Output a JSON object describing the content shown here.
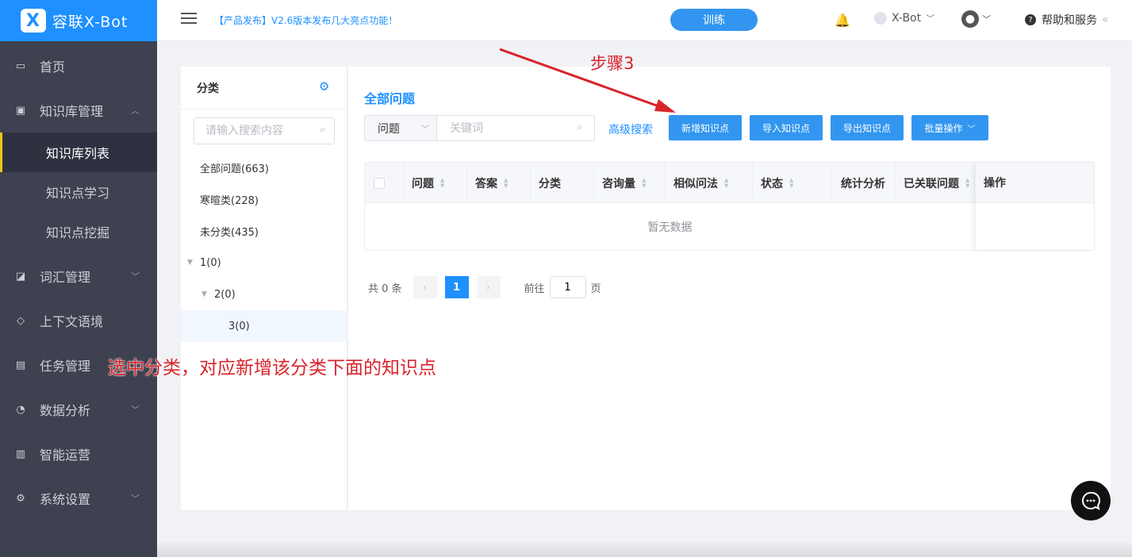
{
  "app": {
    "logo_text": "容联X-Bot",
    "logo_mark": "X"
  },
  "sidebar": {
    "items": [
      {
        "label": "首页",
        "icon": "monitor-icon"
      },
      {
        "label": "知识库管理",
        "icon": "book-icon"
      },
      {
        "label": "词汇管理",
        "icon": "vocab-icon"
      },
      {
        "label": "上下文语境",
        "icon": "context-icon"
      },
      {
        "label": "任务管理",
        "icon": "task-icon"
      },
      {
        "label": "数据分析",
        "icon": "analytics-icon"
      },
      {
        "label": "智能运营",
        "icon": "operation-icon"
      },
      {
        "label": "系统设置",
        "icon": "settings-icon"
      }
    ],
    "sub_items": [
      {
        "label": "知识库列表"
      },
      {
        "label": "知识点学习"
      },
      {
        "label": "知识点挖掘"
      }
    ]
  },
  "header": {
    "release_notice": "【产品发布】V2.6版本发布几大亮点功能！",
    "train_label": "训练",
    "bot_name": "X-Bot",
    "help_label": "帮助和服务"
  },
  "category": {
    "title": "分类",
    "search_placeholder": "请输入搜索内容",
    "items": [
      {
        "label": "全部问题(663)"
      },
      {
        "label": "寒暄类(228)"
      },
      {
        "label": "未分类(435)"
      },
      {
        "label": "1(0)"
      },
      {
        "label": "2(0)"
      },
      {
        "label": "3(0)"
      }
    ]
  },
  "main": {
    "title": "全部问题",
    "type_select": "问题",
    "keyword_placeholder": "关键词",
    "advanced_search": "高级搜索",
    "buttons": {
      "add": "新增知识点",
      "import": "导入知识点",
      "export": "导出知识点",
      "batch": "批量操作"
    },
    "columns": [
      "问题",
      "答案",
      "分类",
      "咨询量",
      "相似问法",
      "状态",
      "统计分析",
      "已关联问题",
      "操作"
    ],
    "empty_text": "暂无数据"
  },
  "pagination": {
    "total": "共 0 条",
    "current": "1",
    "goto_label": "前往",
    "goto_value": "1",
    "page_suffix": "页"
  },
  "annotations": {
    "step": "步骤3",
    "note": "选中分类，对应新增该分类下面的知识点",
    "color": "#d9232a"
  },
  "colors": {
    "accent": "#1e90ff",
    "sidebar_bg": "#3d4150",
    "highlight": "#f5c518"
  }
}
